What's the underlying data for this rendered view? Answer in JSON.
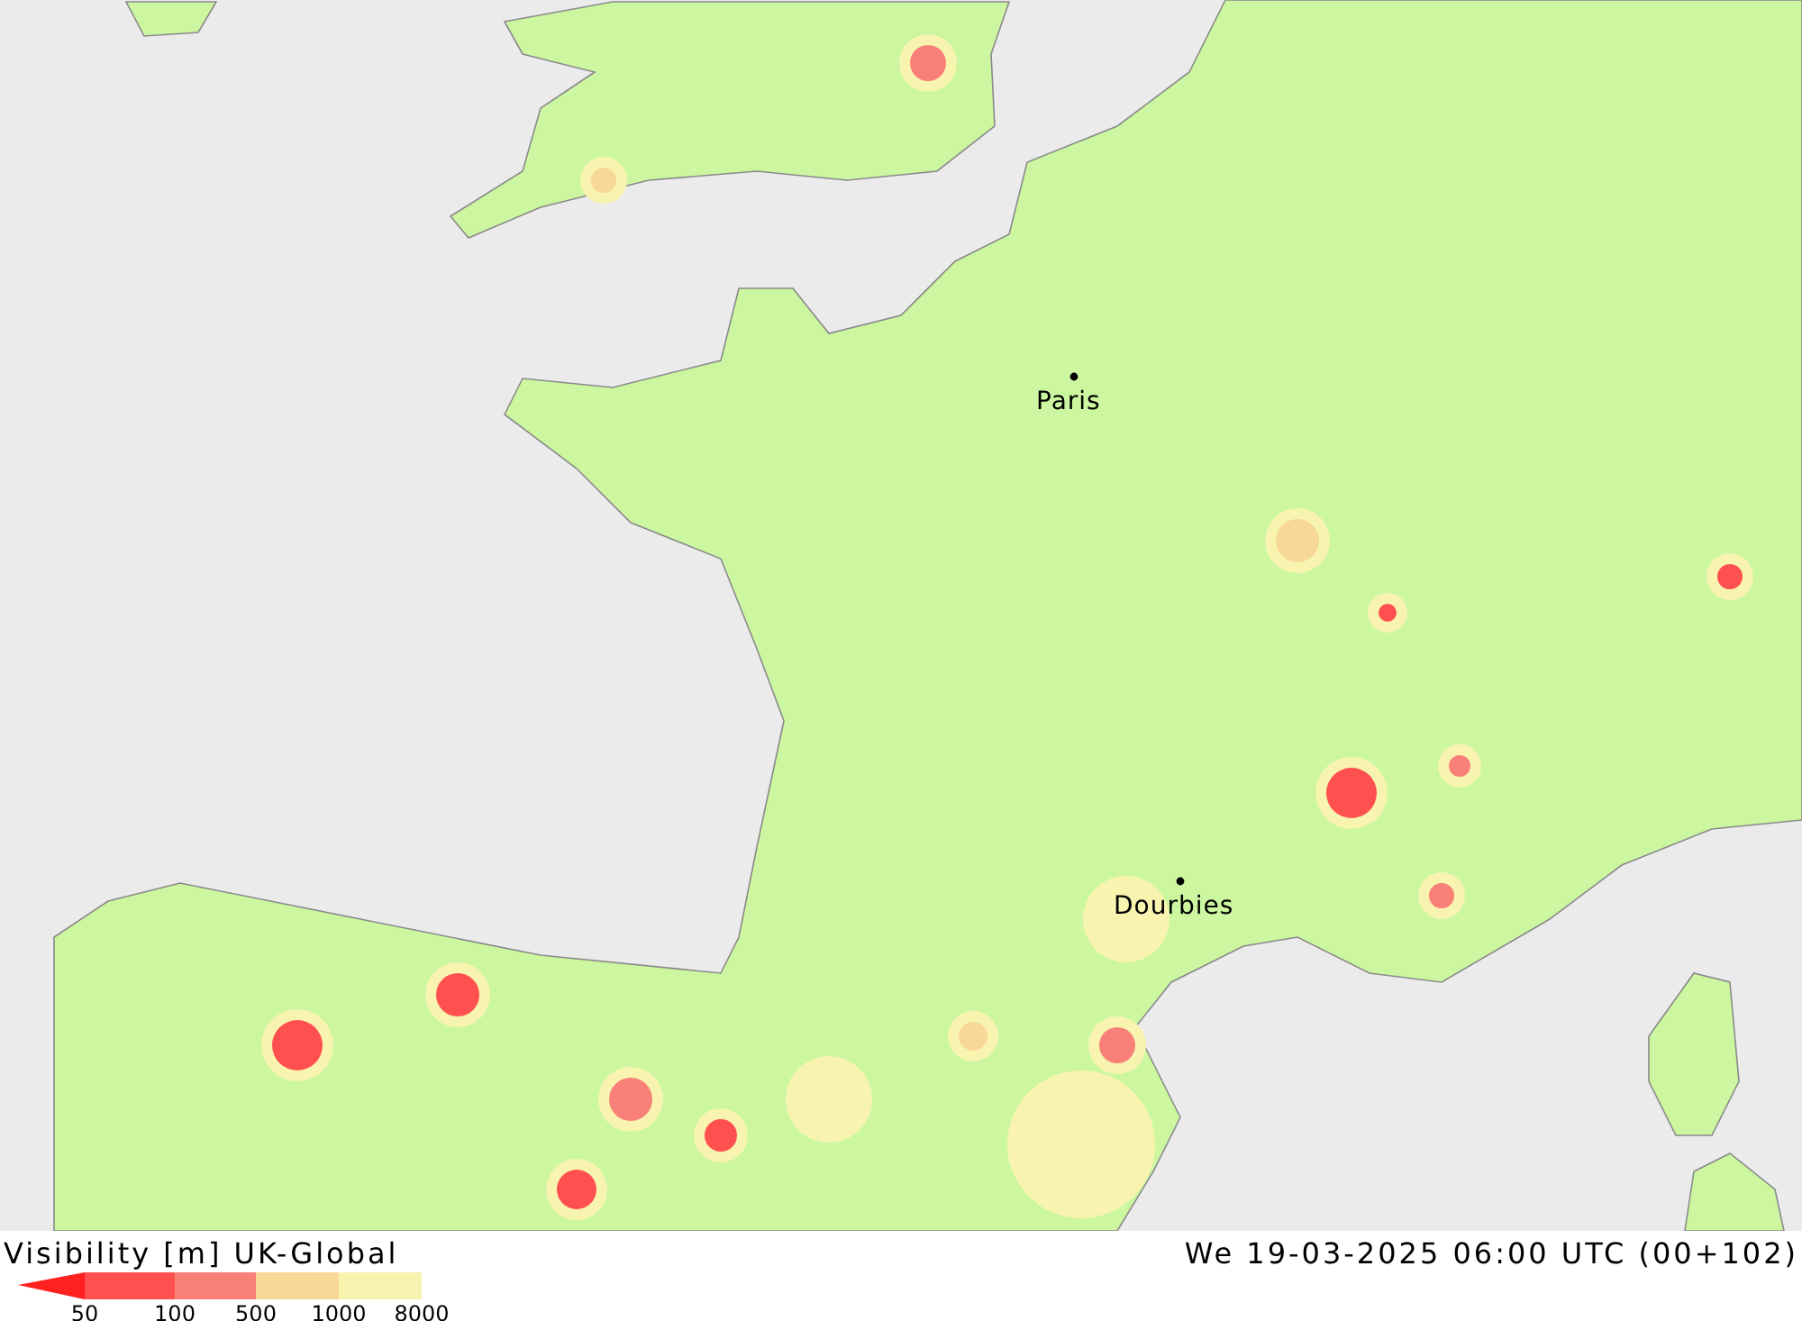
{
  "map": {
    "cities": [
      {
        "name": "Paris"
      },
      {
        "name": "Dourbies"
      }
    ]
  },
  "footer": {
    "title": "Visibility [m] UK-Global",
    "valid_time": "We 19-03-2025 06:00 UTC (00+102)"
  },
  "legend": {
    "bands": [
      {
        "color": "#ff2020"
      },
      {
        "color": "#ff5050"
      },
      {
        "color": "#f88078"
      },
      {
        "color": "#f8d898"
      },
      {
        "color": "#f8f4b0"
      }
    ],
    "labels": [
      "50",
      "100",
      "500",
      "1000",
      "8000"
    ]
  }
}
